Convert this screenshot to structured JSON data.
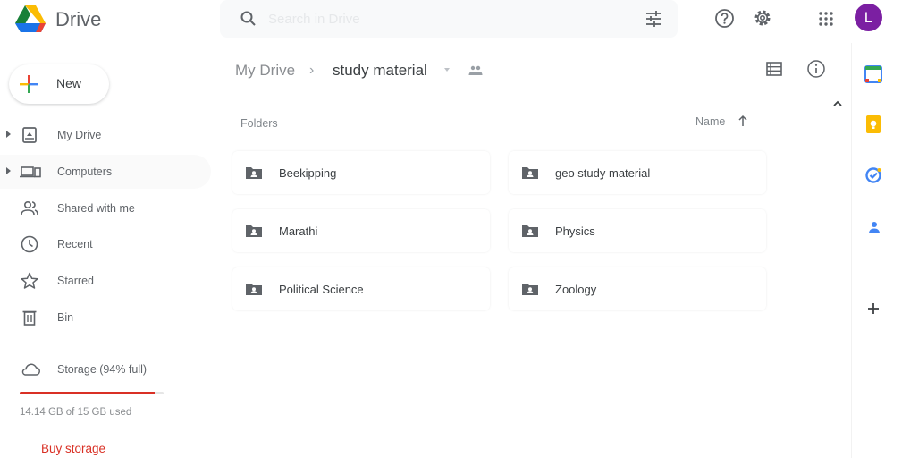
{
  "app": {
    "name": "Drive",
    "brand_colors": {
      "green": "#188038",
      "yellow": "#fbbc04",
      "blue": "#1a73e8",
      "red": "#d93025"
    }
  },
  "header": {
    "search_placeholder": "Search in Drive",
    "icons": [
      "search-icon",
      "tune-icon",
      "help-icon",
      "gear-icon",
      "apps-icon"
    ],
    "avatar_letter": "L",
    "avatar_color": "#7b1fa2"
  },
  "sidebar": {
    "new_label": "New",
    "items": [
      {
        "label": "My Drive",
        "icon": "my-drive-icon",
        "expandable": true
      },
      {
        "label": "Computers",
        "icon": "computers-icon",
        "expandable": true
      },
      {
        "label": "Shared with me",
        "icon": "shared-icon",
        "expandable": false
      },
      {
        "label": "Recent",
        "icon": "clock-icon",
        "expandable": false
      },
      {
        "label": "Starred",
        "icon": "star-icon",
        "expandable": false
      },
      {
        "label": "Bin",
        "icon": "bin-icon",
        "expandable": false
      },
      {
        "label": "Storage (94% full)",
        "icon": "cloud-icon",
        "expandable": false
      }
    ],
    "storage": {
      "fraction_used": 0.94,
      "used_text": "14.14 GB of 15 GB used",
      "bar_color": "#d93025"
    },
    "buy_storage_label": "Buy storage"
  },
  "main": {
    "breadcrumb": {
      "root": "My Drive",
      "separator": "›",
      "current": "study material"
    },
    "section_label": "Folders",
    "sort": {
      "label": "Name",
      "direction": "ascending"
    },
    "folders": [
      {
        "name": "Beekipping"
      },
      {
        "name": "geo study material"
      },
      {
        "name": "Marathi"
      },
      {
        "name": "Physics"
      },
      {
        "name": "Political Science"
      },
      {
        "name": "Zoology"
      }
    ]
  },
  "side_panel": {
    "apps": [
      "calendar-icon",
      "keep-icon",
      "tasks-icon",
      "contacts-icon",
      "add-addon-icon"
    ]
  }
}
